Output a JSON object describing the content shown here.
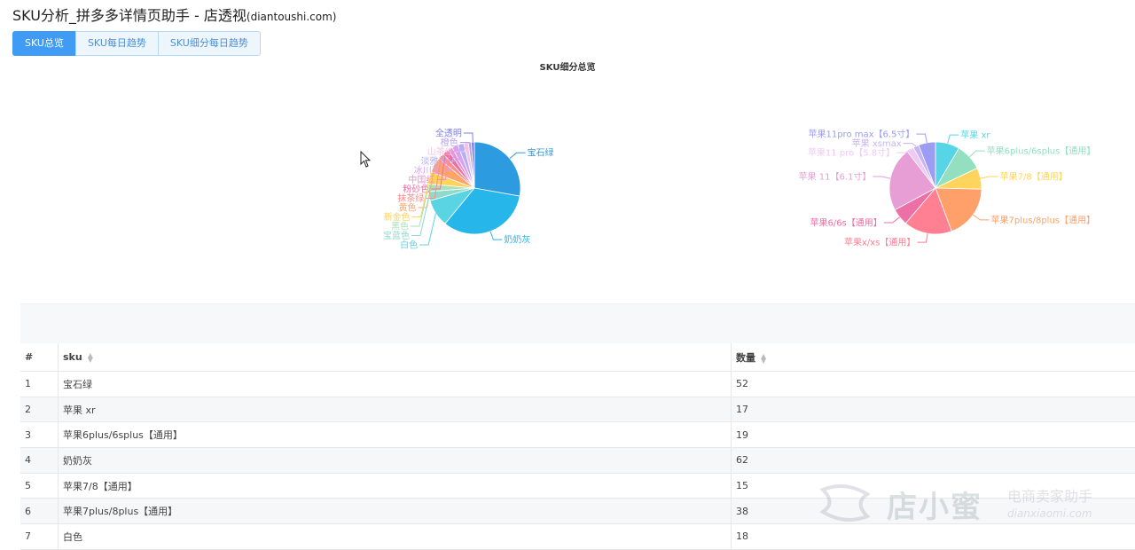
{
  "header": {
    "title": "SKU分析_拼多多详情页助手 - 店透视",
    "domain": "(diantoushi.com)"
  },
  "tabs": [
    {
      "label": "SKU总览",
      "active": true
    },
    {
      "label": "SKU每日趋势",
      "active": false
    },
    {
      "label": "SKU细分每日趋势",
      "active": false
    }
  ],
  "charts_title": "SKU细分总览",
  "chart_data": [
    {
      "type": "pie",
      "title": "",
      "slices": [
        {
          "name": "宝石绿",
          "value": 52,
          "color": "#2d9be0"
        },
        {
          "name": "奶奶灰",
          "value": 62,
          "color": "#27b6ea"
        },
        {
          "name": "白色",
          "value": 18,
          "color": "#5ad4e2"
        },
        {
          "name": "宝蓝色",
          "value": 6,
          "color": "#8edbc9"
        },
        {
          "name": "黑色",
          "value": 5,
          "color": "#a9e2b8"
        },
        {
          "name": "新金色",
          "value": 8,
          "color": "#ffd35a"
        },
        {
          "name": "黄色",
          "value": 10,
          "color": "#ffa36b"
        },
        {
          "name": "抹茶绿",
          "value": 4,
          "color": "#ff8a8a"
        },
        {
          "name": "粉砂色",
          "value": 4,
          "color": "#f06fa1"
        },
        {
          "name": "中国红",
          "value": 3,
          "color": "#ec8fd1"
        },
        {
          "name": "冰川蓝",
          "value": 4,
          "color": "#d99ef0"
        },
        {
          "name": "淡雅紫",
          "value": 4,
          "color": "#b5b0f5"
        },
        {
          "name": "山茶红",
          "value": 3,
          "color": "#f3c4e0"
        },
        {
          "name": "橙色",
          "value": 2,
          "color": "#b6a1f0"
        },
        {
          "name": "全透明",
          "value": 2,
          "color": "#7d7ee8"
        }
      ]
    },
    {
      "type": "pie",
      "title": "",
      "slices": [
        {
          "name": "苹果 xr",
          "value": 17,
          "color": "#57d4e6"
        },
        {
          "name": "苹果6plus/6splus【通用】",
          "value": 19,
          "color": "#93e0c0"
        },
        {
          "name": "苹果7/8【通用】",
          "value": 15,
          "color": "#ffd45c"
        },
        {
          "name": "苹果7plus/8plus【通用】",
          "value": 38,
          "color": "#ffa06b"
        },
        {
          "name": "苹果x/xs【通用】",
          "value": 34,
          "color": "#ff7f93"
        },
        {
          "name": "苹果6/6s【通用】",
          "value": 12,
          "color": "#ec6fa5"
        },
        {
          "name": "苹果 11【6.1寸】",
          "value": 45,
          "color": "#e79ed4"
        },
        {
          "name": "苹果11 pro【5.8寸】",
          "value": 5,
          "color": "#efc8f3"
        },
        {
          "name": "苹果 xsmax",
          "value": 4,
          "color": "#c6b4f6"
        },
        {
          "name": "苹果11pro max【6.5寸】",
          "value": 12,
          "color": "#9c9cf2"
        }
      ]
    }
  ],
  "table": {
    "headers": {
      "idx": "#",
      "sku": "sku",
      "qty": "数量"
    },
    "rows": [
      {
        "idx": "1",
        "sku": "宝石绿",
        "qty": "52"
      },
      {
        "idx": "2",
        "sku": "苹果 xr",
        "qty": "17"
      },
      {
        "idx": "3",
        "sku": "苹果6plus/6splus【通用】",
        "qty": "19"
      },
      {
        "idx": "4",
        "sku": "奶奶灰",
        "qty": "62"
      },
      {
        "idx": "5",
        "sku": "苹果7/8【通用】",
        "qty": "15"
      },
      {
        "idx": "6",
        "sku": "苹果7plus/8plus【通用】",
        "qty": "38"
      },
      {
        "idx": "7",
        "sku": "白色",
        "qty": "18"
      }
    ]
  },
  "watermark": {
    "big": "店小蜜",
    "small": "电商卖家助手",
    "url": "dianxiaomi.com"
  }
}
